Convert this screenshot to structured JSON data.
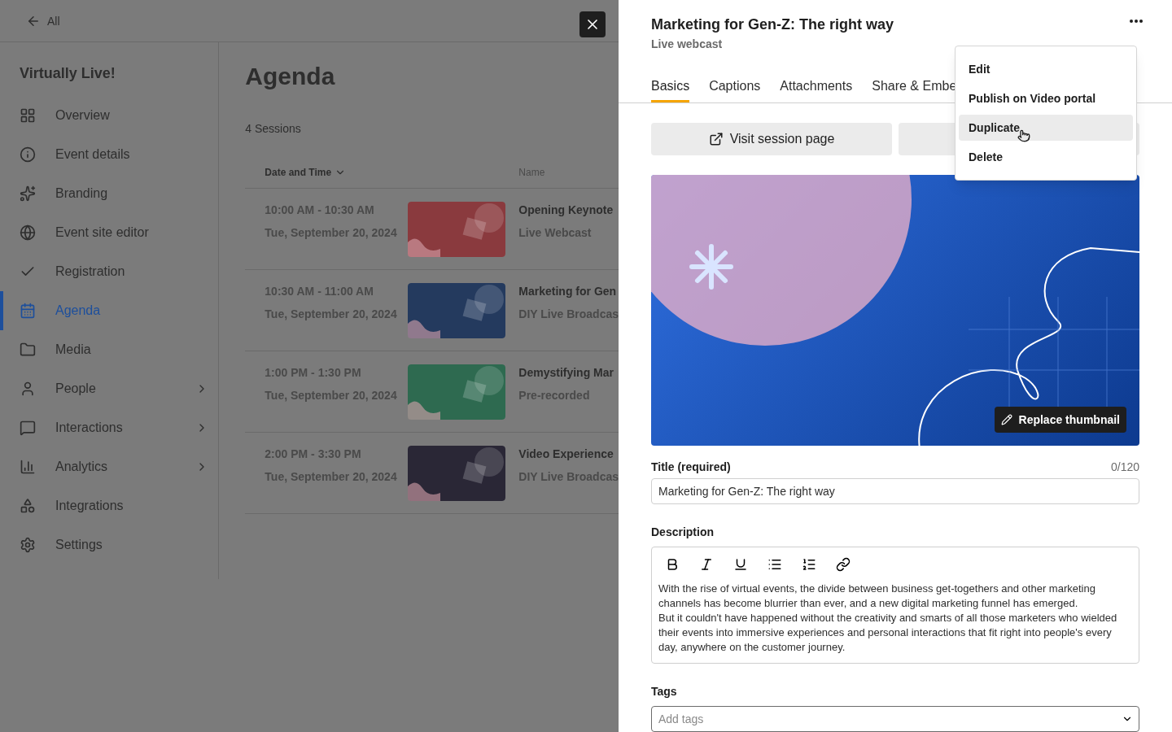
{
  "back_link": {
    "label": "All"
  },
  "sidebar": {
    "title": "Virtually Live!",
    "items": [
      {
        "label": "Overview",
        "selected": false,
        "has_submenu": false
      },
      {
        "label": "Event details",
        "selected": false,
        "has_submenu": false
      },
      {
        "label": "Branding",
        "selected": false,
        "has_submenu": false
      },
      {
        "label": "Event site editor",
        "selected": false,
        "has_submenu": false
      },
      {
        "label": "Registration",
        "selected": false,
        "has_submenu": false
      },
      {
        "label": "Agenda",
        "selected": true,
        "has_submenu": false
      },
      {
        "label": "Media",
        "selected": false,
        "has_submenu": false
      },
      {
        "label": "People",
        "selected": false,
        "has_submenu": true
      },
      {
        "label": "Interactions",
        "selected": false,
        "has_submenu": true
      },
      {
        "label": "Analytics",
        "selected": false,
        "has_submenu": true
      },
      {
        "label": "Integrations",
        "selected": false,
        "has_submenu": false
      },
      {
        "label": "Settings",
        "selected": false,
        "has_submenu": false
      }
    ]
  },
  "agenda": {
    "title": "Agenda",
    "count": "4 Sessions",
    "columns": [
      "Date and Time",
      "Name"
    ],
    "sessions": [
      {
        "time": "10:00 AM - 10:30 AM",
        "date": "Tue, September 20, 2024",
        "name": "Opening Keynote",
        "type": "Live Webcast",
        "color": "#8a3a3e"
      },
      {
        "time": "10:30 AM - 11:00 AM",
        "date": "Tue, September 20, 2024",
        "name": "Marketing for Gen",
        "type": "DIY Live Broadcas",
        "color": "#243a5e"
      },
      {
        "time": "1:00 PM - 1:30 PM",
        "date": "Tue, September 20, 2024",
        "name": "Demystifying Mar",
        "type": "Pre-recorded",
        "color": "#2e6a50"
      },
      {
        "time": "2:00 PM - 3:30 PM",
        "date": "Tue, September 20, 2024",
        "name": "Video Experience",
        "type": "DIY Live Broadcas",
        "color": "#2a2736"
      }
    ]
  },
  "panel": {
    "title": "Marketing for Gen-Z: The right way",
    "subtitle": "Live webcast",
    "tabs": [
      {
        "label": "Basics",
        "selected": true
      },
      {
        "label": "Captions",
        "selected": false
      },
      {
        "label": "Attachments",
        "selected": false
      },
      {
        "label": "Share & Embe",
        "selected": false
      }
    ],
    "visit_button": "Visit session page",
    "replace_button": "Replace thumbnail",
    "title_field": {
      "label": "Title (required)",
      "counter": "0/120",
      "value": "Marketing for Gen-Z: The right way"
    },
    "description": {
      "label": "Description",
      "text": "With the rise of virtual events, the divide between business get-togethers and other marketing channels has become blurrier than ever, and a new digital marketing funnel has emerged.\nBut it couldn't have happened without the creativity and smarts of all those marketers who wielded their events into immersive experiences and personal interactions that fit right into people's every day, anywhere on the customer journey."
    },
    "tags": {
      "label": "Tags",
      "placeholder": "Add tags"
    }
  },
  "menu": {
    "items": [
      {
        "label": "Edit",
        "highlighted": false
      },
      {
        "label": "Publish on Video portal",
        "highlighted": false
      },
      {
        "label": "Duplicate",
        "highlighted": true
      },
      {
        "label": "Delete",
        "highlighted": false
      }
    ]
  }
}
